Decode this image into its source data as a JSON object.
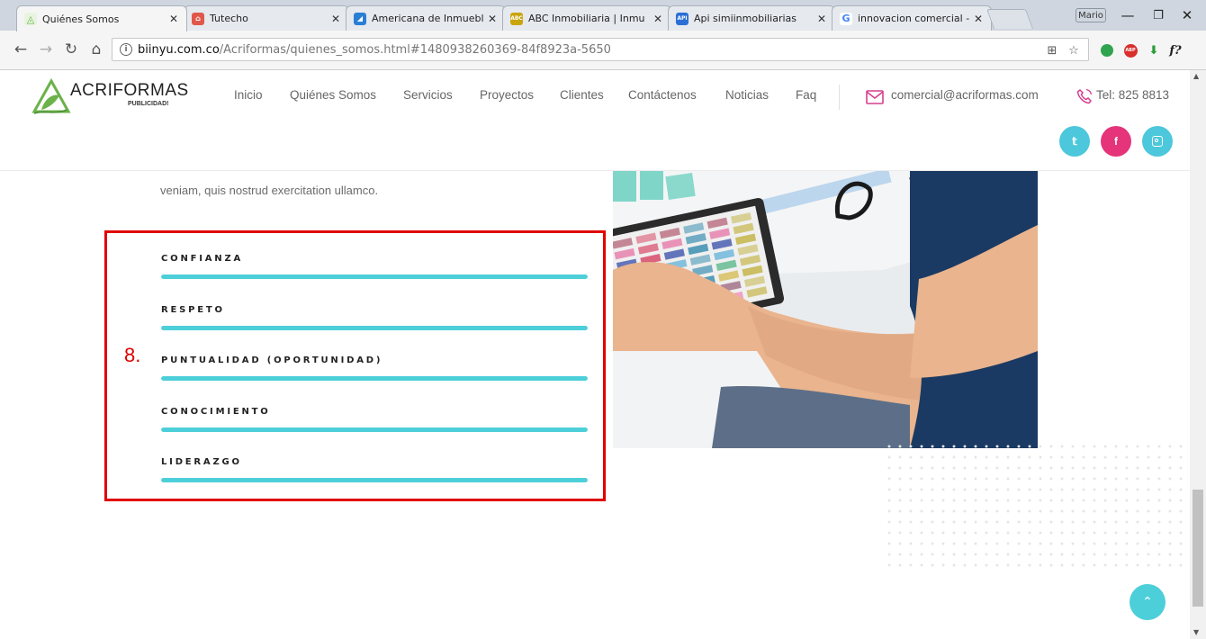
{
  "browser": {
    "tabs": [
      {
        "title": "Quiénes Somos",
        "fav_color": "#6bb24a",
        "fav_glyph": "◬"
      },
      {
        "title": "Tutecho",
        "fav_color": "#e0584a",
        "fav_glyph": "⌂"
      },
      {
        "title": "Americana de Inmueble",
        "fav_color": "#2a7fd4",
        "fav_glyph": "◢"
      },
      {
        "title": "ABC Inmobiliaria | Inmu",
        "fav_color": "#c9a40a",
        "fav_glyph": "ABC"
      },
      {
        "title": "Api simiinmobiliarias",
        "fav_color": "#2b6fd6",
        "fav_glyph": "API"
      },
      {
        "title": "innovacion comercial - ",
        "fav_color": "#ffffff",
        "fav_glyph": "G"
      }
    ],
    "profile_label": "Mario",
    "url_domain": "biinyu.com.co",
    "url_path": "/Acriformas/quienes_somos.html#1480938260369-84f8923a-5650"
  },
  "header": {
    "logo_text": "ACRIFORMAS",
    "logo_subtext": "PUBLICIDAD!",
    "nav": [
      "Inicio",
      "Quiénes Somos",
      "Servicios",
      "Proyectos",
      "Clientes",
      "Contáctenos",
      "Noticias",
      "Faq"
    ],
    "email": "comercial@acriformas.com",
    "phone": "Tel: 825 8813",
    "social": [
      "twitter",
      "facebook",
      "instagram"
    ]
  },
  "content": {
    "intro_text": "veniam, quis nostrud exercitation ullamco.",
    "annotation_number": "8.",
    "skills": [
      {
        "label": "CONFIANZA",
        "level": 1.0
      },
      {
        "label": "RESPETO",
        "level": 1.0
      },
      {
        "label": "PUNTUALIDAD (OPORTUNIDAD)",
        "level": 1.0
      },
      {
        "label": "CONOCIMIENTO",
        "level": 1.0
      },
      {
        "label": "LIDERAZGO",
        "level": 1.0
      }
    ]
  },
  "colors": {
    "accent": "#4ccfd9",
    "annotation_red": "#e00000",
    "twitter": "#4cc7db",
    "facebook": "#e5347a",
    "instagram": "#4cc7db",
    "email_icon": "#d63f8e",
    "phone_icon": "#d63f8e"
  }
}
